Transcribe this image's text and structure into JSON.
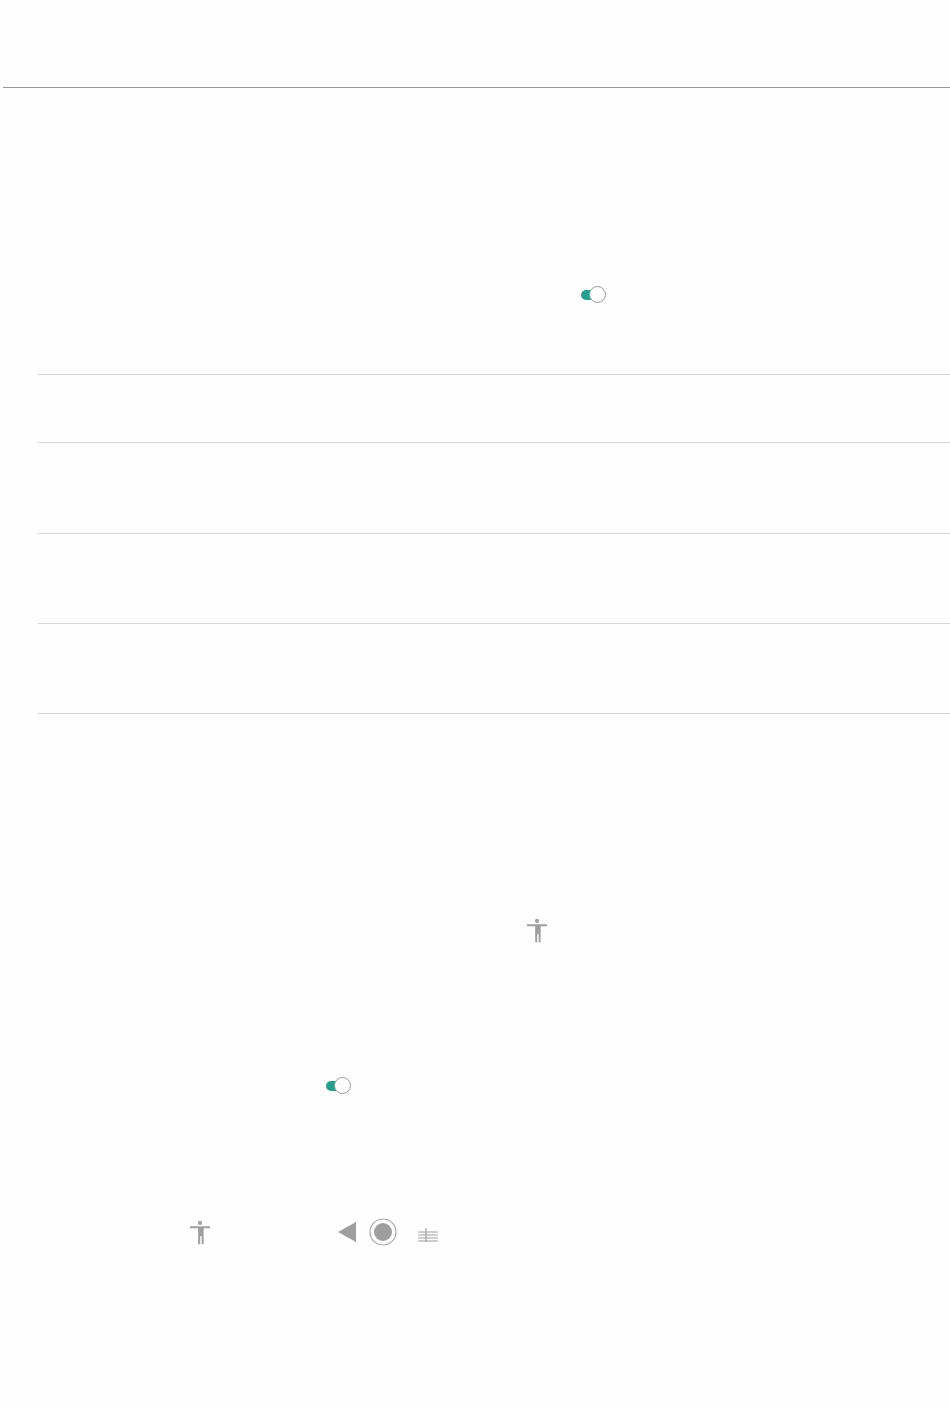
{
  "toggles": [
    {
      "on": true
    },
    {
      "on": true
    }
  ]
}
